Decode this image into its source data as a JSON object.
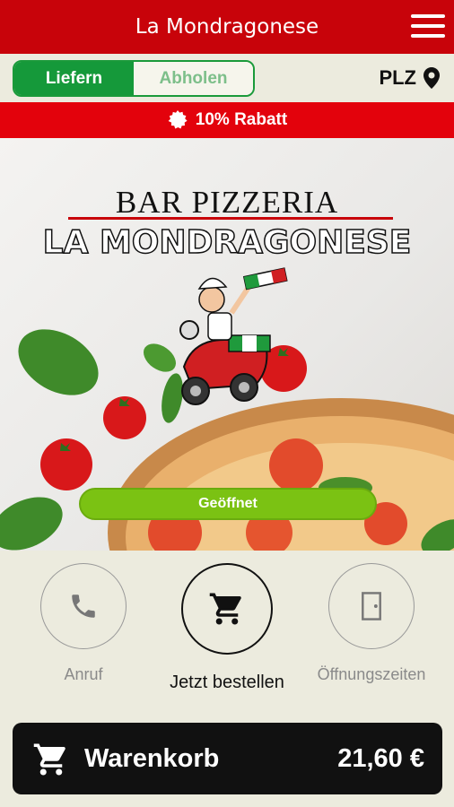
{
  "header": {
    "title": "La Mondragonese",
    "menu_icon": "hamburger-menu-icon"
  },
  "mode": {
    "delivery_label": "Liefern",
    "pickup_label": "Abholen",
    "selected": "Liefern"
  },
  "postcode": {
    "label": "PLZ",
    "icon": "location-pin-icon"
  },
  "promo": {
    "text": "10% Rabatt",
    "icon": "badge-icon"
  },
  "hero": {
    "line1": "BAR PIZZERIA",
    "line2": "LA MONDRAGONESE",
    "status_label": "Geöffnet"
  },
  "actions": {
    "call_label": "Anruf",
    "order_label": "Jetzt bestellen",
    "hours_label": "Öffnungszeiten"
  },
  "cart": {
    "label": "Warenkorb",
    "total": "21,60 €",
    "icon": "cart-icon"
  },
  "colors": {
    "brand_red": "#c8030a",
    "promo_red": "#e3020c",
    "green": "#15993a",
    "open_green": "#7bc213",
    "dark": "#111111"
  }
}
